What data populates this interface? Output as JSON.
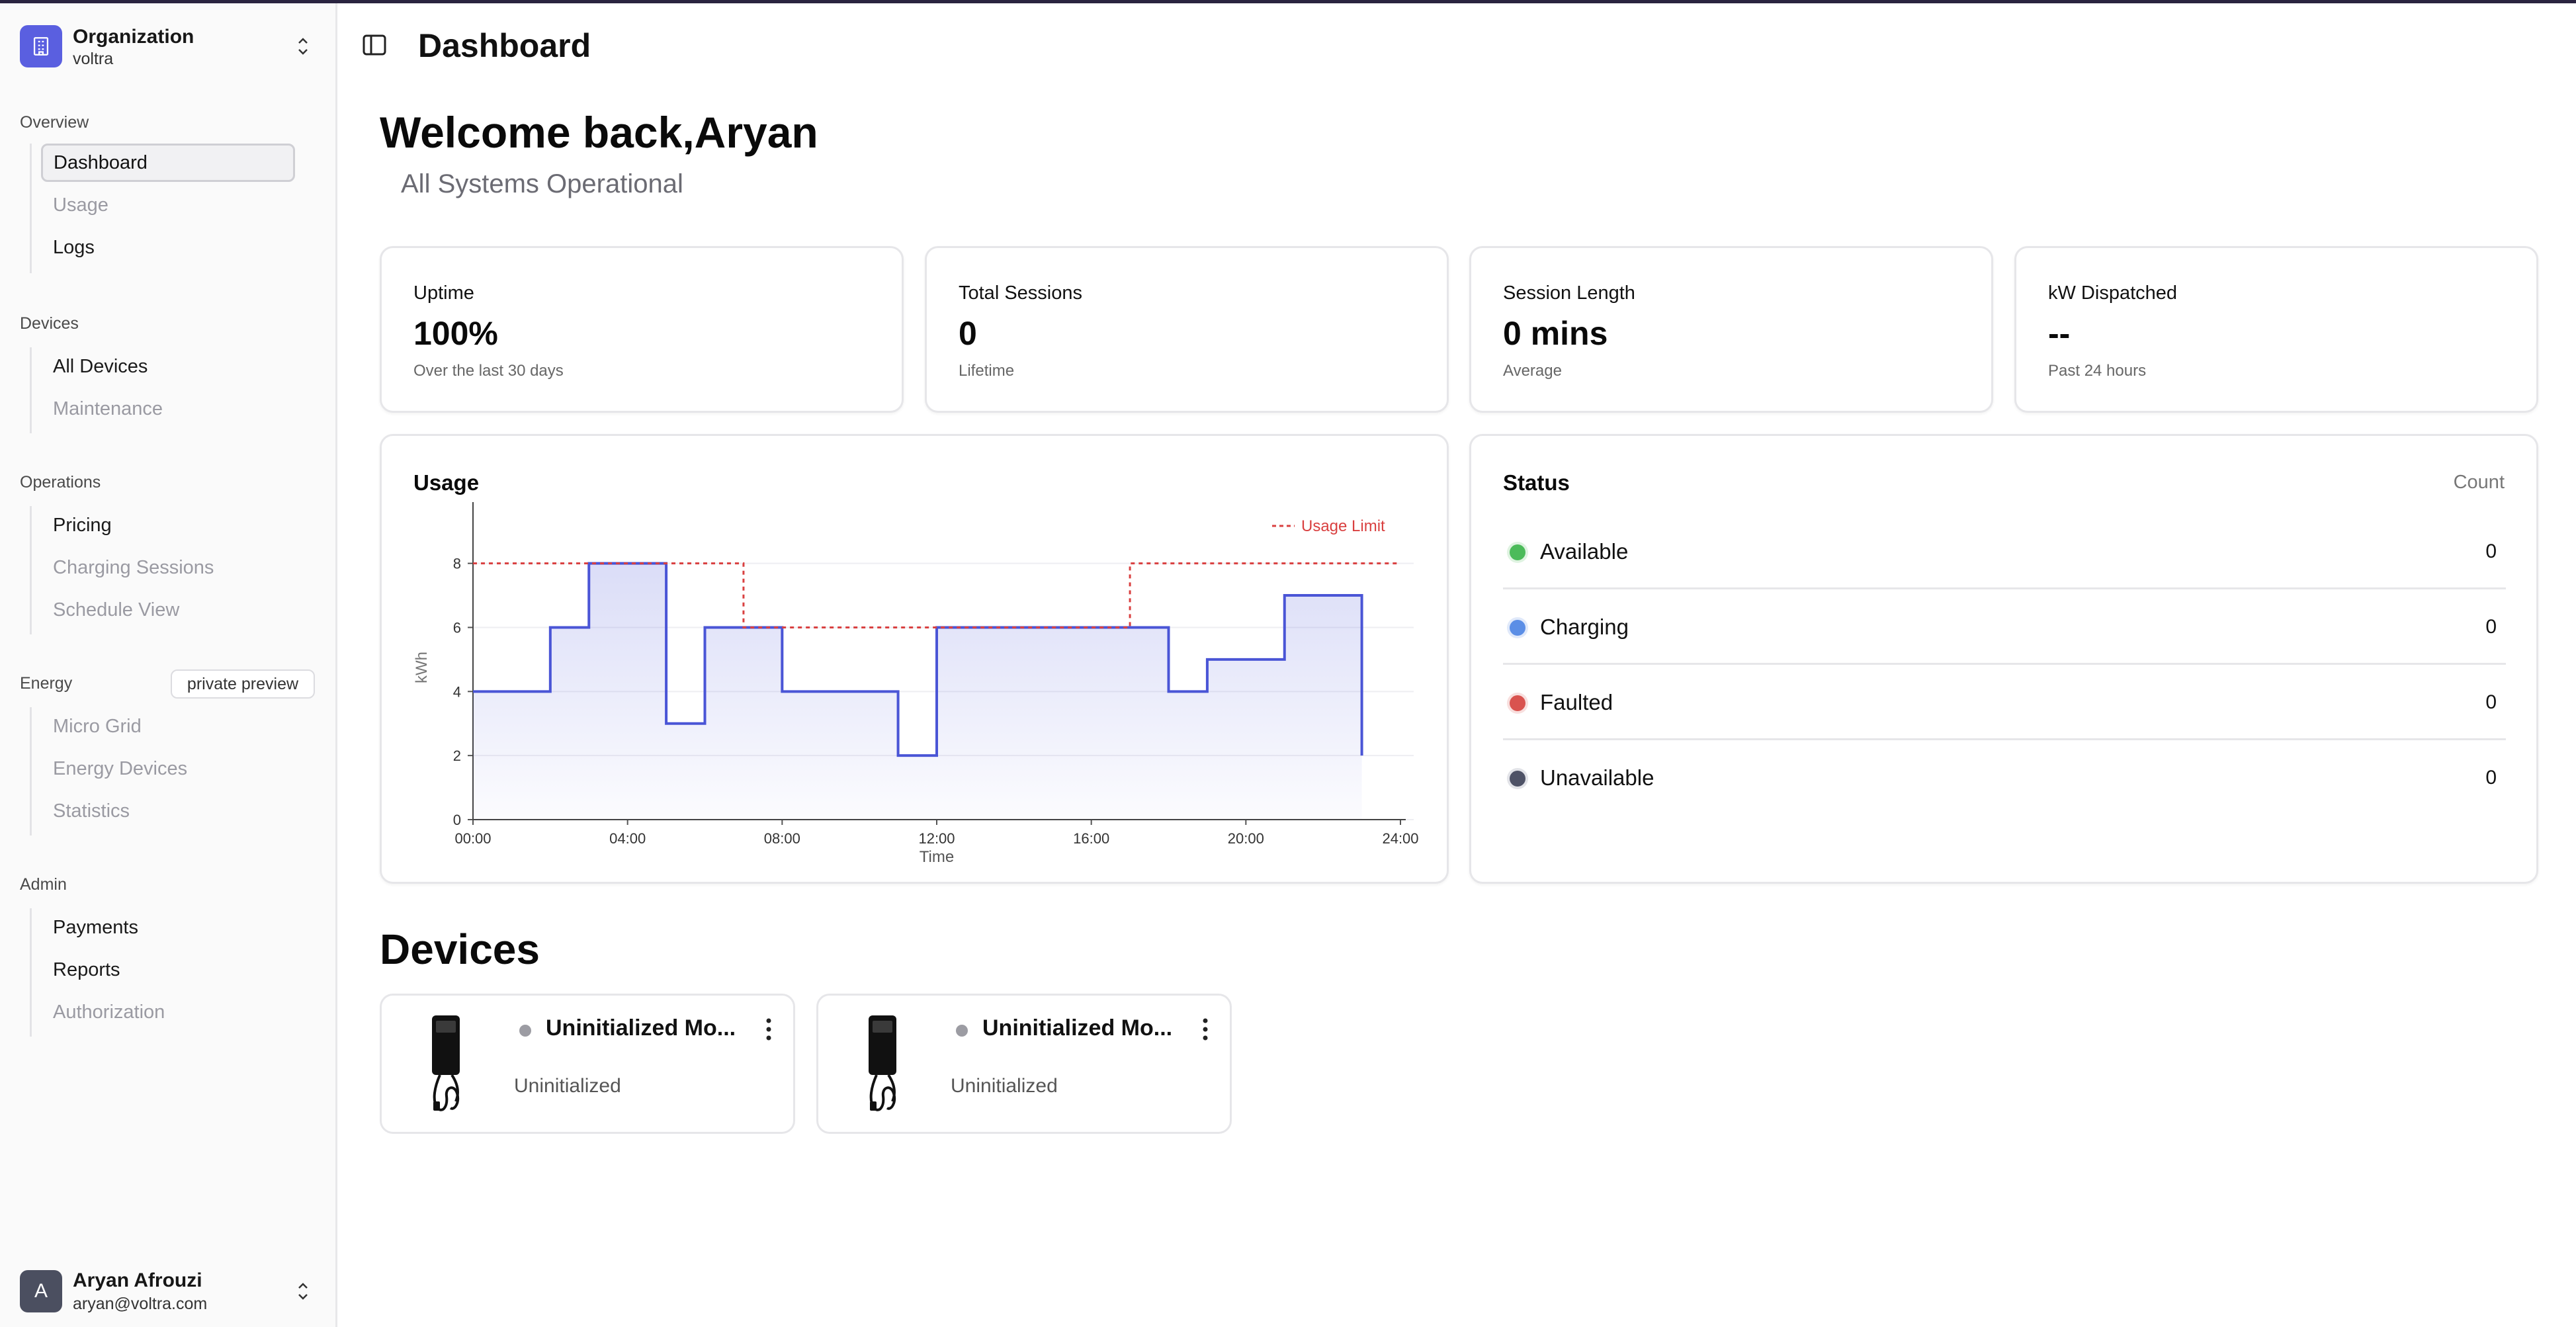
{
  "organization": {
    "label": "Organization",
    "name": "voltra"
  },
  "sidebar": {
    "groups": [
      {
        "label": "Overview",
        "items": [
          {
            "label": "Dashboard",
            "state": "active"
          },
          {
            "label": "Usage",
            "state": "disabled"
          },
          {
            "label": "Logs",
            "state": "normal"
          }
        ]
      },
      {
        "label": "Devices",
        "items": [
          {
            "label": "All Devices",
            "state": "normal"
          },
          {
            "label": "Maintenance",
            "state": "disabled"
          }
        ]
      },
      {
        "label": "Operations",
        "items": [
          {
            "label": "Pricing",
            "state": "normal"
          },
          {
            "label": "Charging Sessions",
            "state": "disabled"
          },
          {
            "label": "Schedule View",
            "state": "disabled"
          }
        ]
      },
      {
        "label": "Energy",
        "badge": "private preview",
        "items": [
          {
            "label": "Micro Grid",
            "state": "disabled"
          },
          {
            "label": "Energy Devices",
            "state": "disabled"
          },
          {
            "label": "Statistics",
            "state": "disabled"
          }
        ]
      },
      {
        "label": "Admin",
        "items": [
          {
            "label": "Payments",
            "state": "normal"
          },
          {
            "label": "Reports",
            "state": "normal"
          },
          {
            "label": "Authorization",
            "state": "disabled"
          }
        ]
      }
    ]
  },
  "user": {
    "initial": "A",
    "name": "Aryan Afrouzi",
    "email": "aryan@voltra.com"
  },
  "header": {
    "title": "Dashboard"
  },
  "welcome": {
    "greeting": "Welcome back,Aryan",
    "system_status": "All Systems Operational"
  },
  "stats": [
    {
      "title": "Uptime",
      "value": "100%",
      "sub": "Over the last 30 days"
    },
    {
      "title": "Total Sessions",
      "value": "0",
      "sub": "Lifetime"
    },
    {
      "title": "Session Length",
      "value": "0 mins",
      "sub": "Average"
    },
    {
      "title": "kW Dispatched",
      "value": "--",
      "sub": "Past 24 hours"
    }
  ],
  "usage_card": {
    "title": "Usage"
  },
  "status_card": {
    "title": "Status",
    "count_label": "Count",
    "rows": [
      {
        "label": "Available",
        "count": "0",
        "color": "#4cbb5a"
      },
      {
        "label": "Charging",
        "count": "0",
        "color": "#5b8ee6"
      },
      {
        "label": "Faulted",
        "count": "0",
        "color": "#d9534f"
      },
      {
        "label": "Unavailable",
        "count": "0",
        "color": "#4e5266"
      }
    ]
  },
  "devices_section": {
    "title": "Devices",
    "devices": [
      {
        "name": "Uninitialized Mo...",
        "status": "Uninitialized"
      },
      {
        "name": "Uninitialized Mo...",
        "status": "Uninitialized"
      }
    ]
  },
  "colors": {
    "accent": "#5a5fe0",
    "usage_line": "#4a55d6",
    "limit_line": "#d94040"
  },
  "chart_data": {
    "type": "area",
    "step": true,
    "xlabel": "Time",
    "ylabel": "kWh",
    "x_ticks": [
      "00:00",
      "04:00",
      "08:00",
      "12:00",
      "16:00",
      "20:00",
      "24:00"
    ],
    "y_ticks": [
      0,
      2,
      4,
      6,
      8
    ],
    "xlim": [
      0,
      24
    ],
    "ylim": [
      0,
      9.5
    ],
    "grid": true,
    "series": [
      {
        "values": [
          [
            0,
            4
          ],
          [
            1,
            4
          ],
          [
            2,
            6
          ],
          [
            3,
            8
          ],
          [
            4,
            8
          ],
          [
            5,
            3
          ],
          [
            6,
            6
          ],
          [
            7,
            6
          ],
          [
            8,
            4
          ],
          [
            9,
            4
          ],
          [
            10,
            4
          ],
          [
            11,
            2
          ],
          [
            12,
            6
          ],
          [
            13,
            6
          ],
          [
            14,
            6
          ],
          [
            15,
            6
          ],
          [
            16,
            6
          ],
          [
            17,
            6
          ],
          [
            18,
            4
          ],
          [
            19,
            5
          ],
          [
            20,
            5
          ],
          [
            21,
            7
          ],
          [
            22,
            7
          ],
          [
            23,
            2
          ]
        ]
      }
    ],
    "limit": {
      "name": "Usage Limit",
      "steps": [
        [
          0,
          8
        ],
        [
          7,
          6
        ],
        [
          17,
          8
        ]
      ],
      "end": 24
    },
    "legend": "top-right"
  }
}
